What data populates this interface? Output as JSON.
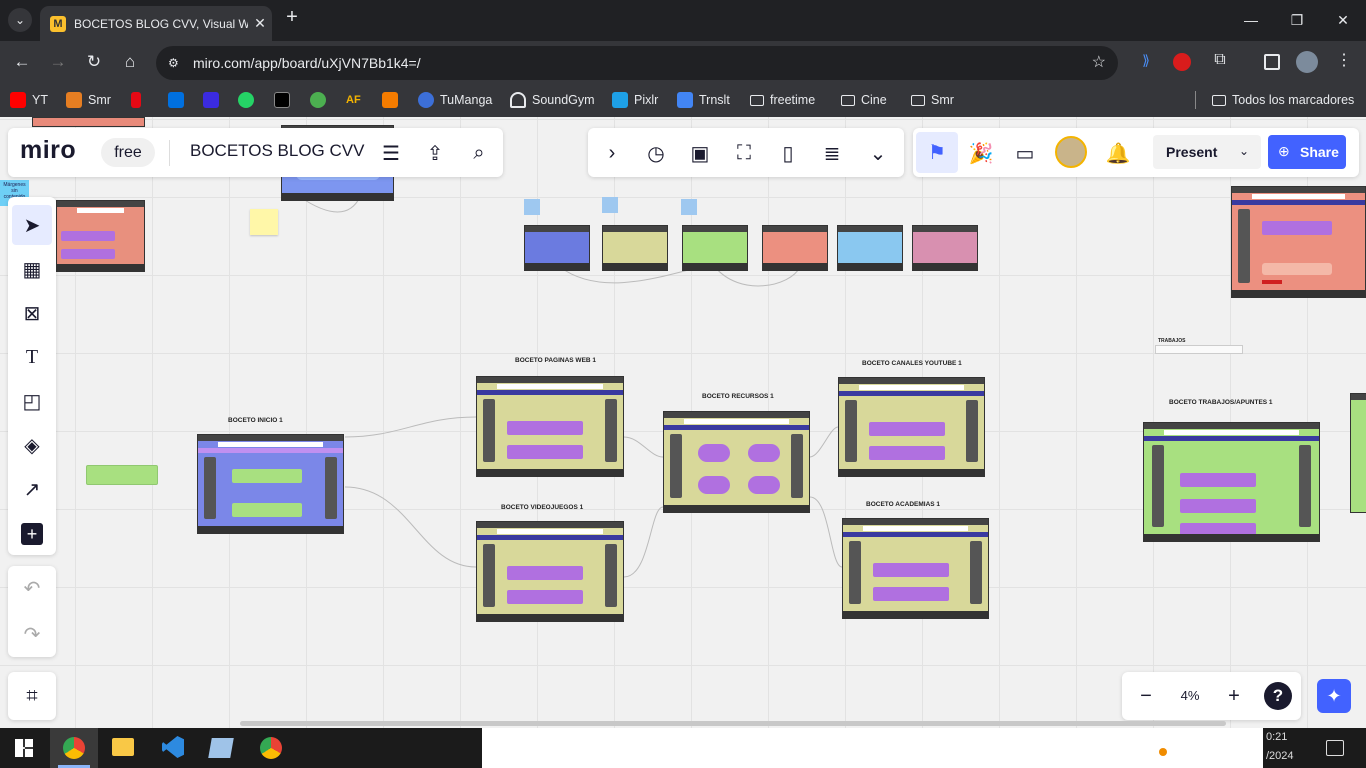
{
  "browser": {
    "tab_title": "BOCETOS BLOG CVV, Visual Wo",
    "url": "miro.com/app/board/uXjVN7Bb1k4=/",
    "bookmarks": [
      "YT",
      "Smr",
      "TuManga",
      "SoundGym",
      "Pixlr",
      "Trnslt",
      "freetime",
      "Cine",
      "Smr"
    ],
    "all_bookmarks": "Todos los marcadores"
  },
  "miro": {
    "logo": "miro",
    "plan": "free",
    "board_name": "BOCETOS BLOG CVV",
    "present_label": "Present",
    "share_label": "Share",
    "zoom": "4%",
    "help": "?"
  },
  "board": {
    "labels": {
      "inicio": "BOCETO INICIO 1",
      "paginas": "BOCETO PAGINAS WEB 1",
      "recursos": "BOCETO RECURSOS 1",
      "canales": "BOCETO CANALES YOUTUBE 1",
      "videojuegos": "BOCETO VIDEOJUEGOS 1",
      "academias": "BOCETO ACADEMIAS 1",
      "trabajos": "BOCETO TRABAJOS/APUNTES 1"
    },
    "sticky_cyan": "Márgenes sin contenido",
    "trabajos_small": "TRABAJOS"
  },
  "taskbar": {
    "time": "0:21",
    "date": "/2024"
  },
  "colors": {
    "accent": "#4262ff",
    "miro_yellow": "#ffd02f"
  }
}
